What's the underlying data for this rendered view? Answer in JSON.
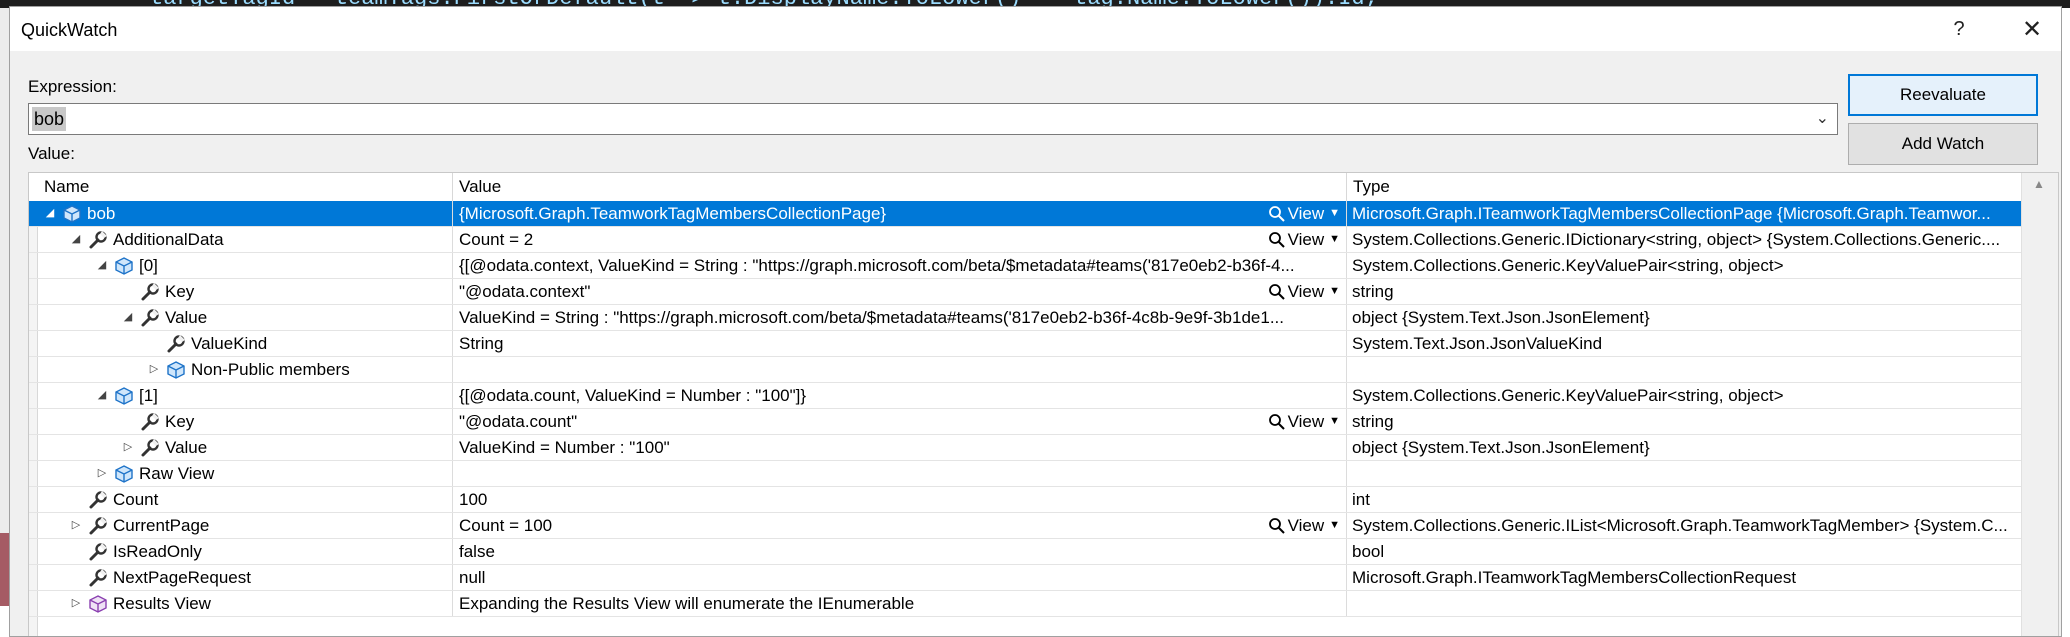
{
  "background": {
    "code_text": "targetTagId = teamTags.FirstOrDefault(t => t.DisplayName.ToLower() == tag.Name.ToLower()).Id;"
  },
  "dialog": {
    "title": "QuickWatch",
    "help_label": "?",
    "close_label": "✕",
    "expression_label": "Expression:",
    "expression_value": "bob",
    "value_label": "Value:",
    "reevaluate_label": "Reevaluate",
    "add_watch_label": "Add Watch"
  },
  "grid": {
    "columns": {
      "name": "Name",
      "value": "Value",
      "type": "Type"
    },
    "view_label": "View",
    "rows": [
      {
        "level": 0,
        "expand": "open",
        "icon": "object-icon",
        "name": "bob",
        "value": "{Microsoft.Graph.TeamworkTagMembersCollectionPage}",
        "type": "Microsoft.Graph.ITeamworkTagMembersCollectionPage {Microsoft.Graph.Teamwor...",
        "view": true,
        "selected": true
      },
      {
        "level": 1,
        "expand": "open",
        "icon": "wrench-icon",
        "name": "AdditionalData",
        "value": "Count = 2",
        "type": "System.Collections.Generic.IDictionary<string, object> {System.Collections.Generic....",
        "view": true
      },
      {
        "level": 2,
        "expand": "open",
        "icon": "object-icon",
        "name": "[0]",
        "value": "{[@odata.context, ValueKind = String : \"https://graph.microsoft.com/beta/$metadata#teams('817e0eb2-b36f-4...",
        "type": "System.Collections.Generic.KeyValuePair<string, object>"
      },
      {
        "level": 3,
        "expand": "none",
        "icon": "wrench-icon",
        "name": "Key",
        "value": "\"@odata.context\"",
        "type": "string",
        "view": true
      },
      {
        "level": 3,
        "expand": "open",
        "icon": "wrench-icon",
        "name": "Value",
        "value": "ValueKind = String : \"https://graph.microsoft.com/beta/$metadata#teams('817e0eb2-b36f-4c8b-9e9f-3b1de1...",
        "type": "object {System.Text.Json.JsonElement}"
      },
      {
        "level": 4,
        "expand": "none",
        "icon": "wrench-icon",
        "name": "ValueKind",
        "value": "String",
        "type": "System.Text.Json.JsonValueKind"
      },
      {
        "level": 4,
        "expand": "closed",
        "icon": "object-icon",
        "name": "Non-Public members",
        "value": "",
        "type": ""
      },
      {
        "level": 2,
        "expand": "open",
        "icon": "object-icon",
        "name": "[1]",
        "value": "{[@odata.count, ValueKind = Number : \"100\"]}",
        "type": "System.Collections.Generic.KeyValuePair<string, object>"
      },
      {
        "level": 3,
        "expand": "none",
        "icon": "wrench-icon",
        "name": "Key",
        "value": "\"@odata.count\"",
        "type": "string",
        "view": true
      },
      {
        "level": 3,
        "expand": "closed",
        "icon": "wrench-icon",
        "name": "Value",
        "value": "ValueKind = Number : \"100\"",
        "type": "object {System.Text.Json.JsonElement}"
      },
      {
        "level": 2,
        "expand": "closed",
        "icon": "object-icon",
        "name": "Raw View",
        "value": "",
        "type": ""
      },
      {
        "level": 1,
        "expand": "none",
        "icon": "wrench-icon",
        "name": "Count",
        "value": "100",
        "type": "int"
      },
      {
        "level": 1,
        "expand": "closed",
        "icon": "wrench-icon",
        "name": "CurrentPage",
        "value": "Count = 100",
        "type": "System.Collections.Generic.IList<Microsoft.Graph.TeamworkTagMember> {System.C...",
        "view": true
      },
      {
        "level": 1,
        "expand": "none",
        "icon": "wrench-icon",
        "name": "IsReadOnly",
        "value": "false",
        "type": "bool"
      },
      {
        "level": 1,
        "expand": "none",
        "icon": "wrench-icon",
        "name": "NextPageRequest",
        "value": "null",
        "type": "Microsoft.Graph.ITeamworkTagMembersCollectionRequest"
      },
      {
        "level": 1,
        "expand": "closed",
        "icon": "cube-icon",
        "name": "Results View",
        "value": "Expanding the Results View will enumerate the IEnumerable",
        "type": ""
      }
    ]
  }
}
